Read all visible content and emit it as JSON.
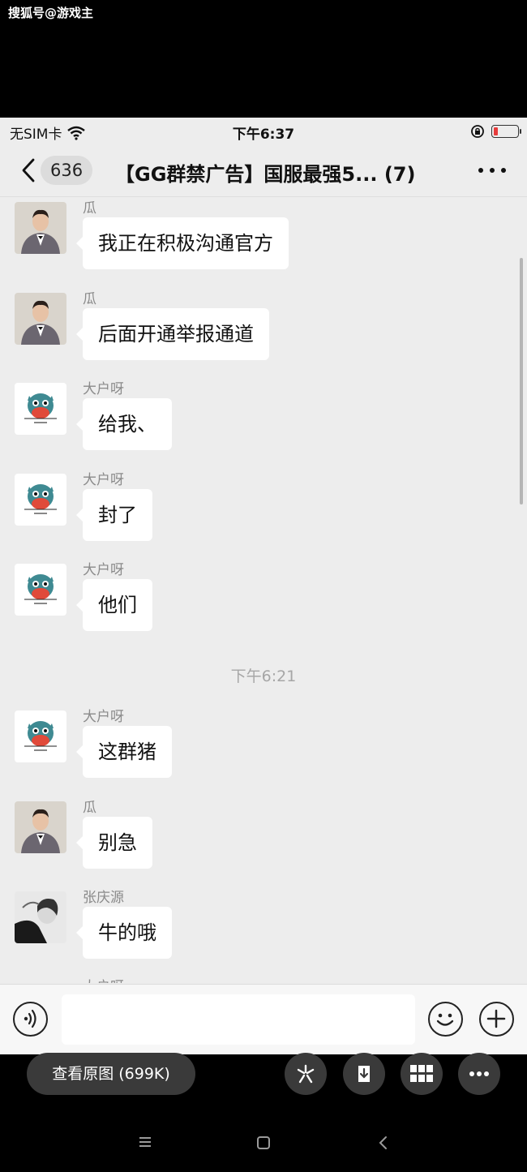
{
  "watermark": "搜狐号@游戏主",
  "status_bar": {
    "carrier": "无SIM卡",
    "time": "下午6:37",
    "battery_color": "#e63b3b"
  },
  "header": {
    "back_icon": "chevron-left-icon",
    "unread_count": "636",
    "title": "【GG群禁广告】国服最强5...",
    "member_count": "(7)",
    "more_icon": "more-horizontal-icon"
  },
  "messages": [
    {
      "sender": "瓜",
      "text": "我正在积极沟通官方",
      "avatar": "man-in-suit"
    },
    {
      "sender": "瓜",
      "text": "后面开通举报通道",
      "avatar": "man-in-suit"
    },
    {
      "sender": "大户呀",
      "text": "给我、",
      "avatar": "cartoon-owl"
    },
    {
      "sender": "大户呀",
      "text": "封了",
      "avatar": "cartoon-owl"
    },
    {
      "sender": "大户呀",
      "text": "他们",
      "avatar": "cartoon-owl"
    }
  ],
  "time_separator": "下午6:21",
  "messages_after": [
    {
      "sender": "大户呀",
      "text": "这群猪",
      "avatar": "cartoon-owl"
    },
    {
      "sender": "瓜",
      "text": "别急",
      "avatar": "man-in-suit"
    },
    {
      "sender": "张庆源",
      "text": "牛的哦",
      "avatar": "person-photo"
    }
  ],
  "partial_sender": "大户呀",
  "input_bar": {
    "voice_icon": "voice-icon",
    "placeholder": "",
    "emoji_icon": "emoji-icon",
    "plus_icon": "plus-circle-icon"
  },
  "viewer": {
    "view_original_label": "查看原图 (699K)",
    "buttons": [
      "scan-icon",
      "download-icon",
      "grid-icon",
      "more-icon"
    ]
  },
  "system_nav": [
    "menu-icon",
    "home-icon",
    "back-icon"
  ]
}
